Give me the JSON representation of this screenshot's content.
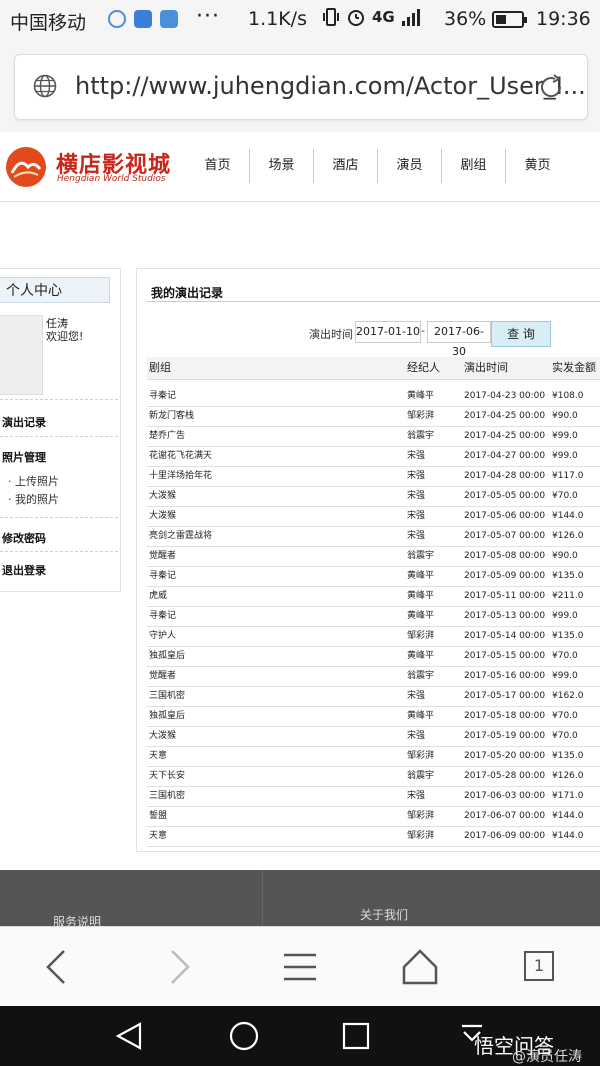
{
  "status_bar": {
    "carrier": "中国移动",
    "dots": "···",
    "speed": "1.1K/s",
    "network": "4G",
    "battery": "36%",
    "battery_level": 0.36,
    "time": "19:36"
  },
  "browser": {
    "url": "http://www.juhengdian.com/Actor_User_I..."
  },
  "site": {
    "logo_cn": "横店影视城",
    "logo_en": "Hengdian World Studios",
    "nav": [
      "首页",
      "场景",
      "酒店",
      "演员",
      "剧组",
      "黄页"
    ]
  },
  "sidebar": {
    "title": "个人中心",
    "username": "任涛",
    "welcome": "欢迎您!",
    "perf_record": "演出记录",
    "photo_manage": "照片管理",
    "upload_photo": "· 上传照片",
    "my_photos": "· 我的照片",
    "change_password": "修改密码",
    "logout": "退出登录"
  },
  "main": {
    "title": "我的演出记录",
    "filter_label": "演出时间",
    "date_from": "2017-01-10",
    "dash": "-",
    "date_to": "2017-06-30",
    "query_button": "查 询",
    "columns": [
      "剧组",
      "经纪人",
      "演出时间",
      "实发金额"
    ],
    "rows": [
      [
        "寻秦记",
        "黄峰平",
        "2017-04-23 00:00",
        "¥108.0"
      ],
      [
        "新龙门客栈",
        "邹彩湃",
        "2017-04-25 00:00",
        "¥90.0"
      ],
      [
        "楚乔广告",
        "翁震宇",
        "2017-04-25 00:00",
        "¥99.0"
      ],
      [
        "花谢花飞花满天",
        "宋强",
        "2017-04-27 00:00",
        "¥99.0"
      ],
      [
        "十里洋场拾年花",
        "宋强",
        "2017-04-28 00:00",
        "¥117.0"
      ],
      [
        "大泼猴",
        "宋强",
        "2017-05-05 00:00",
        "¥70.0"
      ],
      [
        "大泼猴",
        "宋强",
        "2017-05-06 00:00",
        "¥144.0"
      ],
      [
        "亮剑之雷霆战将",
        "宋强",
        "2017-05-07 00:00",
        "¥126.0"
      ],
      [
        "觉醒者",
        "翁震宇",
        "2017-05-08 00:00",
        "¥90.0"
      ],
      [
        "寻秦记",
        "黄峰平",
        "2017-05-09 00:00",
        "¥135.0"
      ],
      [
        "虎威",
        "黄峰平",
        "2017-05-11 00:00",
        "¥211.0"
      ],
      [
        "寻秦记",
        "黄峰平",
        "2017-05-13 00:00",
        "¥99.0"
      ],
      [
        "守护人",
        "邹彩湃",
        "2017-05-14 00:00",
        "¥135.0"
      ],
      [
        "独孤皇后",
        "黄峰平",
        "2017-05-15 00:00",
        "¥70.0"
      ],
      [
        "觉醒者",
        "翁震宇",
        "2017-05-16 00:00",
        "¥99.0"
      ],
      [
        "三国机密",
        "宋强",
        "2017-05-17 00:00",
        "¥162.0"
      ],
      [
        "独孤皇后",
        "黄峰平",
        "2017-05-18 00:00",
        "¥70.0"
      ],
      [
        "大泼猴",
        "宋强",
        "2017-05-19 00:00",
        "¥70.0"
      ],
      [
        "天意",
        "邹彩湃",
        "2017-05-20 00:00",
        "¥135.0"
      ],
      [
        "天下长安",
        "翁震宇",
        "2017-05-28 00:00",
        "¥126.0"
      ],
      [
        "三国机密",
        "宋强",
        "2017-06-03 00:00",
        "¥171.0"
      ],
      [
        "誓盟",
        "邹彩湃",
        "2017-06-07 00:00",
        "¥144.0"
      ],
      [
        "天意",
        "邹彩湃",
        "2017-06-09 00:00",
        "¥144.0"
      ]
    ]
  },
  "footer": {
    "service": "服务说明",
    "about": "关于我们"
  },
  "toolbar": {
    "tab_count": "1"
  },
  "watermark": {
    "line1": "悟空问答",
    "line2": "@演员任涛"
  },
  "colors": {
    "brand_red": "#c8261a",
    "footer_bg": "#555555",
    "query_button_bg": "#d8eef6"
  }
}
